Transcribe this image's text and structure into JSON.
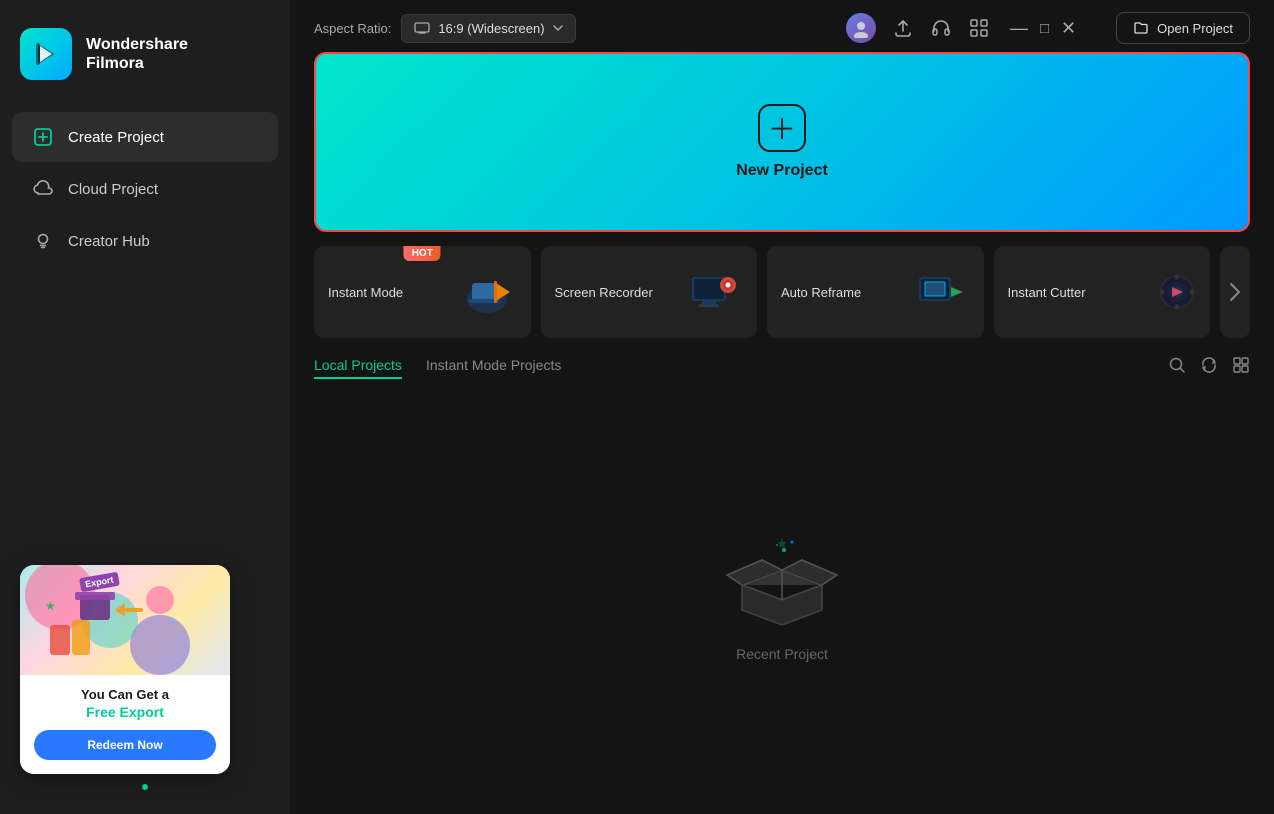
{
  "app": {
    "name": "Wondershare",
    "product": "Filmora"
  },
  "sidebar": {
    "nav_items": [
      {
        "id": "create-project",
        "label": "Create Project",
        "active": true
      },
      {
        "id": "cloud-project",
        "label": "Cloud Project",
        "active": false
      },
      {
        "id": "creator-hub",
        "label": "Creator Hub",
        "active": false
      }
    ]
  },
  "promo": {
    "title": "You Can Get a",
    "highlight": "Free Export",
    "button_label": "Redeem Now"
  },
  "topbar": {
    "aspect_ratio_label": "Aspect Ratio:",
    "aspect_ratio_value": "16:9 (Widescreen)",
    "open_project_label": "Open Project"
  },
  "new_project": {
    "label": "New Project"
  },
  "tools": [
    {
      "id": "instant-mode",
      "label": "Instant Mode",
      "hot": true
    },
    {
      "id": "screen-recorder",
      "label": "Screen Recorder",
      "hot": false
    },
    {
      "id": "auto-reframe",
      "label": "Auto Reframe",
      "hot": false
    },
    {
      "id": "instant-cutter",
      "label": "Instant Cutter",
      "hot": false
    }
  ],
  "tabs": {
    "local": "Local Projects",
    "instant_mode": "Instant Mode Projects"
  },
  "empty_state": {
    "label": "Recent Project"
  },
  "window": {
    "minimize": "—",
    "maximize": "□",
    "close": "✕"
  }
}
